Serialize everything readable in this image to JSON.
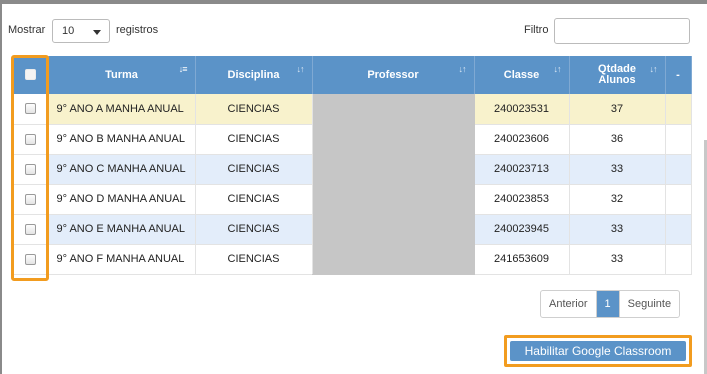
{
  "controls": {
    "show_label": "Mostrar",
    "page_size": "10",
    "records_label": "registros",
    "filter_label": "Filtro",
    "filter_value": ""
  },
  "table": {
    "headers": {
      "turma": "Turma",
      "disciplina": "Disciplina",
      "professor": "Professor",
      "classe": "Classe",
      "qtdade": "Qtdade Alunos",
      "extra": "-"
    },
    "rows": [
      {
        "turma": "9° ANO A MANHA ANUAL",
        "disciplina": "CIENCIAS",
        "professor": "",
        "classe": "240023531",
        "qtdade": "37"
      },
      {
        "turma": "9° ANO B MANHA ANUAL",
        "disciplina": "CIENCIAS",
        "professor": "",
        "classe": "240023606",
        "qtdade": "36"
      },
      {
        "turma": "9° ANO C MANHA ANUAL",
        "disciplina": "CIENCIAS",
        "professor": "",
        "classe": "240023713",
        "qtdade": "33"
      },
      {
        "turma": "9° ANO D MANHA ANUAL",
        "disciplina": "CIENCIAS",
        "professor": "",
        "classe": "240023853",
        "qtdade": "32"
      },
      {
        "turma": "9° ANO E MANHA ANUAL",
        "disciplina": "CIENCIAS",
        "professor": "",
        "classe": "240023945",
        "qtdade": "33"
      },
      {
        "turma": "9° ANO F MANHA ANUAL",
        "disciplina": "CIENCIAS",
        "professor": "",
        "classe": "241653609",
        "qtdade": "33"
      }
    ]
  },
  "pagination": {
    "prev_label": "Anterior",
    "current_page": "1",
    "next_label": "Seguinte"
  },
  "actions": {
    "enable_classroom_label": "Habilitar Google Classroom"
  },
  "colors": {
    "header_blue": "#5b93c8",
    "highlight_orange": "#f29c1f",
    "row_stripe": "#e3edfa",
    "row_selected": "#f8f2cc",
    "redacted_gray": "#c6c6c6"
  },
  "icons": {
    "sort_active": "sort-alpha-down-icon",
    "sort_inactive": "sort-both-icon",
    "dropdown": "caret-down-icon"
  }
}
